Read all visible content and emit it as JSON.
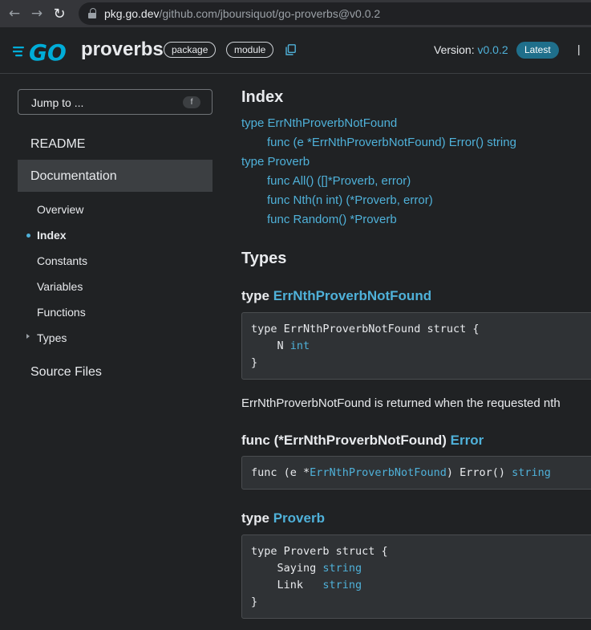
{
  "browser": {
    "url_host": "pkg.go.dev",
    "url_path": "/github.com/jboursiquot/go-proverbs@v0.0.2"
  },
  "header": {
    "package_name": "proverbs",
    "chip_package": "package",
    "chip_module": "module",
    "version_label": "Version:",
    "version_value": "v0.0.2",
    "latest_badge": "Latest",
    "separator": "|"
  },
  "sidebar": {
    "jump_placeholder": "Jump to ...",
    "jump_key": "f",
    "readme": "README",
    "documentation": "Documentation",
    "sub_items": [
      "Overview",
      "Index",
      "Constants",
      "Variables",
      "Functions",
      "Types"
    ],
    "active_sub": "Index",
    "source_files": "Source Files"
  },
  "main": {
    "index_heading": "Index",
    "index_items": [
      "type ErrNthProverbNotFound",
      "func (e *ErrNthProverbNotFound) Error() string",
      "type Proverb",
      "func All() ([]*Proverb, error)",
      "func Nth(n int) (*Proverb, error)",
      "func Random() *Proverb"
    ],
    "types_heading": "Types",
    "type1": {
      "prefix": "type",
      "name": "ErrNthProverbNotFound",
      "code_line1": "type ErrNthProverbNotFound struct {",
      "code_line2_field": "    N ",
      "code_line2_type": "int",
      "code_line3": "}",
      "description": "ErrNthProverbNotFound is returned when the requested nth"
    },
    "func1": {
      "prefix": "func (*ErrNthProverbNotFound)",
      "name": "Error",
      "code_a": "func (e *",
      "code_b": "ErrNthProverbNotFound",
      "code_c": ") Error() ",
      "code_d": "string"
    },
    "type2": {
      "prefix": "type",
      "name": "Proverb",
      "code_line1": "type Proverb struct {",
      "field1": "    Saying ",
      "field1_type": "string",
      "field2": "    Link   ",
      "field2_type": "string",
      "code_line4": "}"
    }
  }
}
